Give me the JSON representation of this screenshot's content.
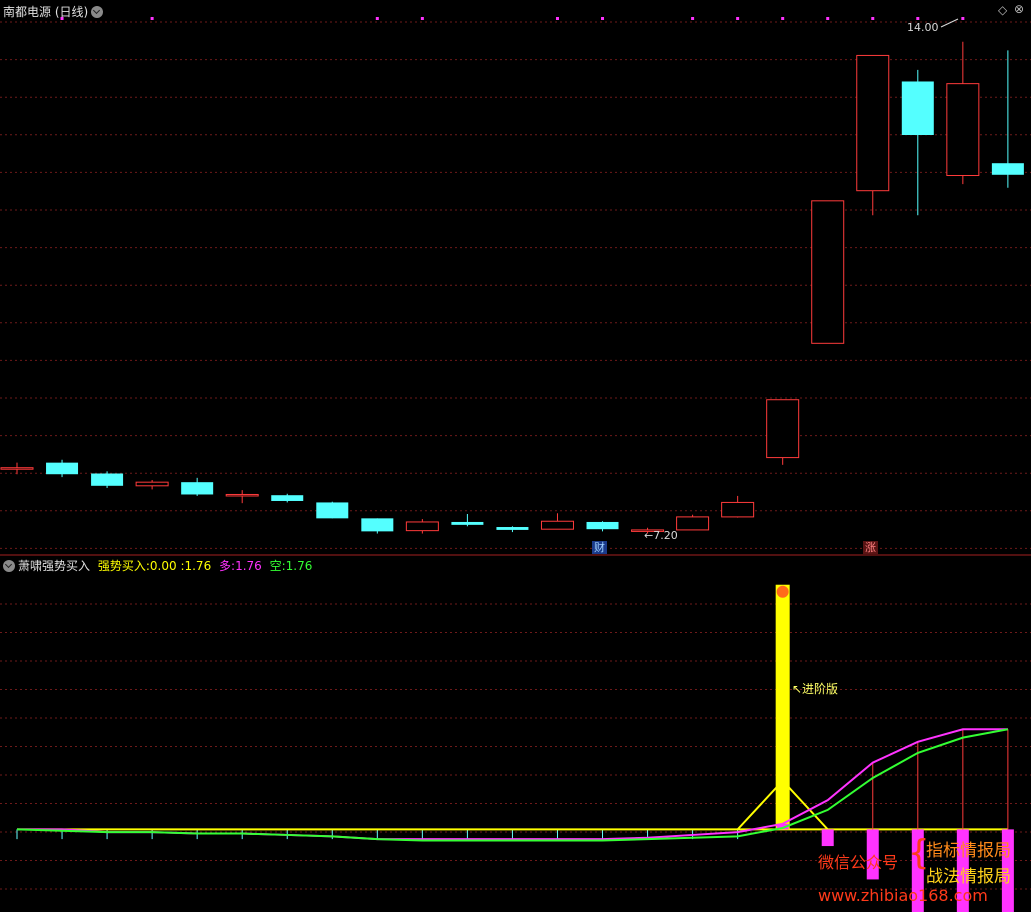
{
  "window": {
    "title": "南都电源 (日线)",
    "controls": [
      "◇",
      "⊗"
    ]
  },
  "indicator": {
    "name": "萧啸强势买入",
    "label_strong": "强势买入:",
    "val_strong": "0.00",
    "val_sep": ":1.76",
    "label_duo": "多:",
    "val_duo": "1.76",
    "label_kong": "空:",
    "val_kong": "1.76"
  },
  "annotations": {
    "high_label": "14.00",
    "low_label": "←7.20",
    "signal_label": "↖进阶版",
    "badge_cai": "财",
    "badge_zhang": "涨"
  },
  "watermark": {
    "left": "微信公众号",
    "right_top": "指标情报局",
    "right_bottom": "战法情报局",
    "url": "www.zhibiao168.com"
  },
  "colors": {
    "up": "#ff3b3b",
    "down": "#54ffff",
    "duo": "#ff33ff",
    "kong": "#33ff33",
    "strong": "#ffff00",
    "grid": "#6e1a1a"
  },
  "chart_data": [
    {
      "type": "candlestick",
      "title": "南都电源 (日线)",
      "ylim": [
        7.0,
        14.3
      ],
      "candles": [
        {
          "o": 8.1,
          "c": 8.11,
          "h": 8.18,
          "l": 8.02
        },
        {
          "o": 8.18,
          "c": 8.02,
          "h": 8.22,
          "l": 7.98
        },
        {
          "o": 8.03,
          "c": 7.86,
          "h": 8.06,
          "l": 7.83
        },
        {
          "o": 7.86,
          "c": 7.91,
          "h": 7.94,
          "l": 7.81
        },
        {
          "o": 7.91,
          "c": 7.74,
          "h": 7.97,
          "l": 7.72
        },
        {
          "o": 7.74,
          "c": 7.74,
          "h": 7.8,
          "l": 7.62
        },
        {
          "o": 7.73,
          "c": 7.65,
          "h": 7.75,
          "l": 7.63
        },
        {
          "o": 7.63,
          "c": 7.41,
          "h": 7.64,
          "l": 7.41
        },
        {
          "o": 7.41,
          "c": 7.23,
          "h": 7.41,
          "l": 7.2
        },
        {
          "o": 7.24,
          "c": 7.36,
          "h": 7.4,
          "l": 7.2
        },
        {
          "o": 7.36,
          "c": 7.32,
          "h": 7.47,
          "l": 7.3
        },
        {
          "o": 7.29,
          "c": 7.25,
          "h": 7.3,
          "l": 7.22
        },
        {
          "o": 7.26,
          "c": 7.37,
          "h": 7.48,
          "l": 7.26
        },
        {
          "o": 7.36,
          "c": 7.26,
          "h": 7.37,
          "l": 7.23
        },
        {
          "o": 7.24,
          "c": 7.25,
          "h": 7.28,
          "l": 7.2
        },
        {
          "o": 7.25,
          "c": 7.43,
          "h": 7.46,
          "l": 7.25
        },
        {
          "o": 7.43,
          "c": 7.63,
          "h": 7.72,
          "l": 7.42
        },
        {
          "o": 8.25,
          "c": 9.05,
          "h": 9.05,
          "l": 8.15
        },
        {
          "o": 9.83,
          "c": 11.8,
          "h": 11.8,
          "l": 9.83
        },
        {
          "o": 11.94,
          "c": 13.81,
          "h": 13.81,
          "l": 11.6
        },
        {
          "o": 13.45,
          "c": 12.71,
          "h": 13.61,
          "l": 11.6
        },
        {
          "o": 12.15,
          "c": 13.42,
          "h": 14.0,
          "l": 12.03
        },
        {
          "o": 12.32,
          "c": 12.16,
          "h": 13.88,
          "l": 11.98
        }
      ],
      "markers_top": [
        1,
        3,
        8,
        9,
        12,
        13,
        15,
        16,
        17,
        18,
        19,
        20,
        21
      ]
    },
    {
      "type": "line",
      "title": "萧啸强势买入",
      "ylim": [
        -0.58,
        1.83
      ],
      "series": [
        {
          "name": "多",
          "values": [
            0,
            0,
            -0.02,
            -0.02,
            -0.03,
            -0.03,
            -0.04,
            -0.05,
            -0.07,
            -0.07,
            -0.07,
            -0.07,
            -0.07,
            -0.07,
            -0.06,
            -0.04,
            -0.02,
            0.04,
            0.21,
            0.48,
            0.63,
            0.72,
            0.72
          ]
        },
        {
          "name": "空",
          "values": [
            0,
            -0.01,
            -0.02,
            -0.02,
            -0.03,
            -0.03,
            -0.04,
            -0.05,
            -0.07,
            -0.08,
            -0.08,
            -0.08,
            -0.08,
            -0.08,
            -0.07,
            -0.06,
            -0.05,
            0.01,
            0.14,
            0.37,
            0.55,
            0.66,
            0.72
          ]
        },
        {
          "name": "强势买入",
          "values": [
            0,
            0,
            0,
            0,
            0,
            0,
            0,
            0,
            0,
            0,
            0,
            0,
            0,
            0,
            0,
            0,
            0,
            1.76,
            0,
            0,
            0,
            0,
            0
          ]
        }
      ],
      "bars": [
        0,
        0,
        0,
        0,
        0,
        0,
        0,
        0,
        0,
        0,
        0,
        0,
        0,
        0,
        0,
        0,
        0,
        0.04,
        -0.12,
        -0.36,
        -0.63,
        -0.61,
        -0.72
      ]
    }
  ]
}
